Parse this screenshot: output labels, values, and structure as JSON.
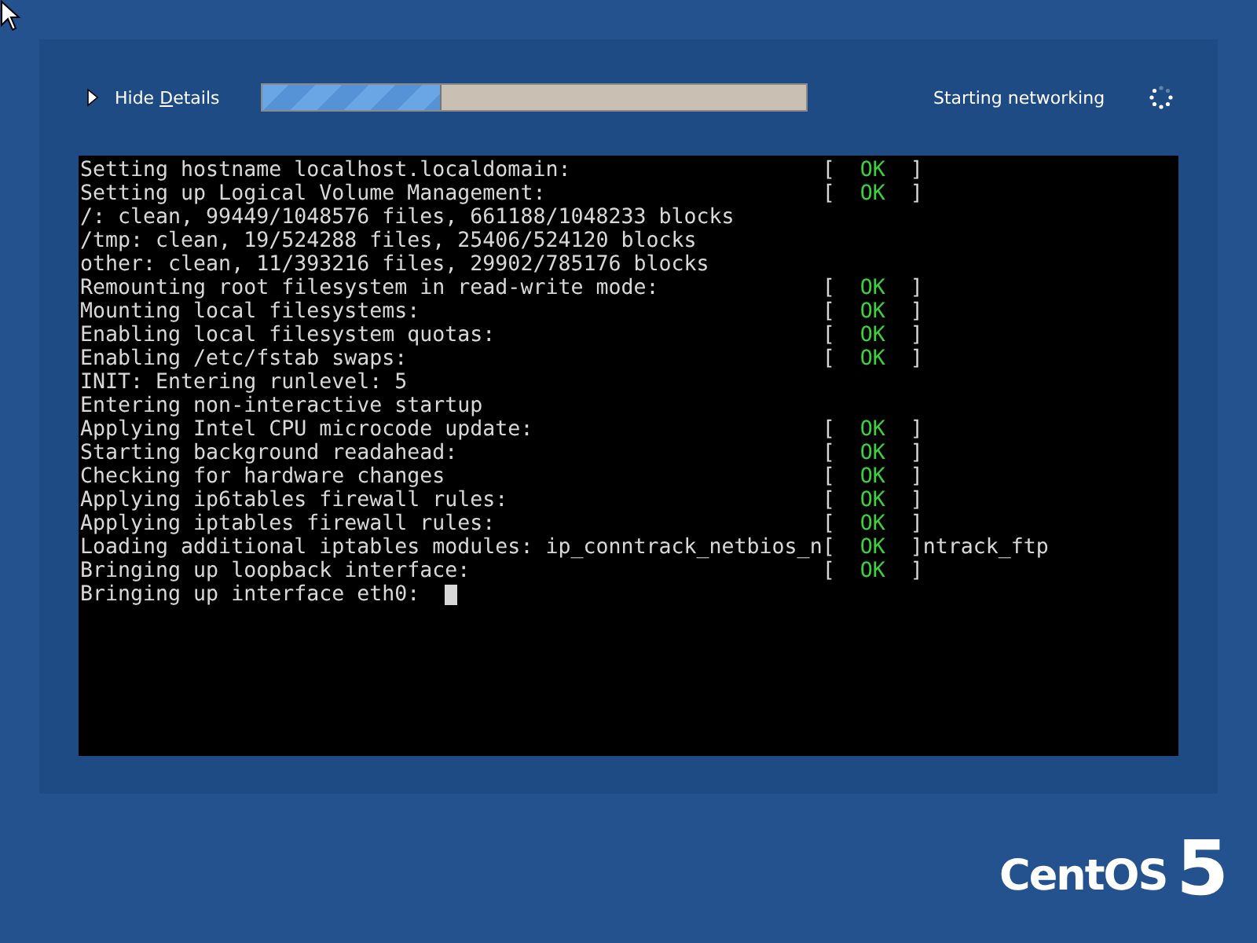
{
  "details_toggle": {
    "label": "Hide ",
    "mnemonic": "D",
    "rest": "etails",
    "expanded": true
  },
  "progress": {
    "level": 0.33
  },
  "status_text": "Starting networking",
  "console": {
    "lines": [
      {
        "text": "Setting hostname localhost.localdomain:",
        "status": {
          "open": "[",
          "label": "OK",
          "close": "]"
        }
      },
      {
        "text": "Setting up Logical Volume Management:",
        "status": {
          "open": "[",
          "label": "OK",
          "close": "]"
        }
      },
      {
        "text": "/: clean, 99449/1048576 files, 661188/1048233 blocks"
      },
      {
        "text": "/tmp: clean, 19/524288 files, 25406/524120 blocks"
      },
      {
        "text": "other: clean, 11/393216 files, 29902/785176 blocks"
      },
      {
        "text": "Remounting root filesystem in read-write mode:",
        "status": {
          "open": "[",
          "label": "OK",
          "close": "]"
        }
      },
      {
        "text": "Mounting local filesystems:",
        "status": {
          "open": "[",
          "label": "OK",
          "close": "]"
        }
      },
      {
        "text": "Enabling local filesystem quotas:",
        "status": {
          "open": "[",
          "label": "OK",
          "close": "]"
        }
      },
      {
        "text": "Enabling /etc/fstab swaps:",
        "status": {
          "open": "[",
          "label": "OK",
          "close": "]"
        }
      },
      {
        "text": "INIT: Entering runlevel: 5"
      },
      {
        "text": "Entering non-interactive startup"
      },
      {
        "text": "Applying Intel CPU microcode update:",
        "status": {
          "open": "[",
          "label": "OK",
          "close": "]"
        }
      },
      {
        "text": "Starting background readahead:",
        "status": {
          "open": "[",
          "label": "OK",
          "close": "]"
        }
      },
      {
        "text": "Checking for hardware changes",
        "status": {
          "open": "[",
          "label": "OK",
          "close": "]"
        }
      },
      {
        "text": "Applying ip6tables firewall rules:",
        "status": {
          "open": "[",
          "label": "OK",
          "close": "]"
        }
      },
      {
        "text": "Applying iptables firewall rules:",
        "status": {
          "open": "[",
          "label": "OK",
          "close": "]"
        }
      },
      {
        "text": "Loading additional iptables modules: ip_conntrack_netbios_n",
        "status": {
          "open": "[",
          "label": "OK",
          "close": "]"
        },
        "tail": "ntrack_ftp"
      },
      {
        "text": "Bringing up loopback interface:",
        "status": {
          "open": "[",
          "label": "OK",
          "close": "]"
        }
      },
      {
        "text": "Bringing up interface eth0:",
        "cursor": true
      }
    ]
  },
  "logo": {
    "name": "CentOS",
    "version": "5"
  }
}
